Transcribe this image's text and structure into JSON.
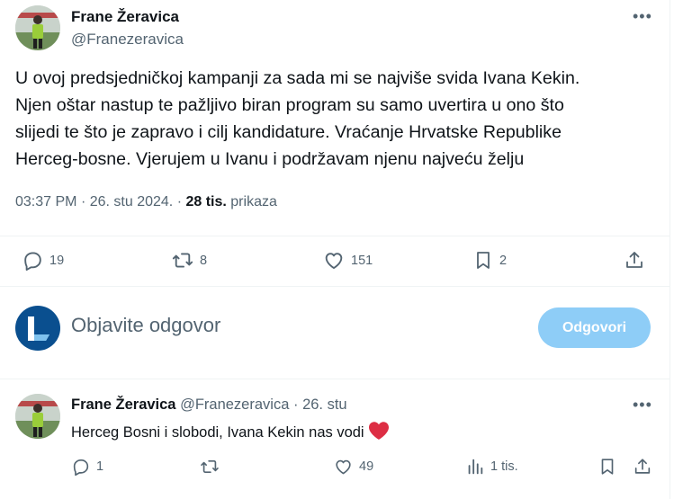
{
  "tweet": {
    "author_name": "Frane Žeravica",
    "author_handle": "@Franezeravica",
    "text": "U ovoj predsjedničkoj kampanji za sada mi se najviše svida Ivana Kekin.\nNjen oštar nastup te pažljivo biran program su samo uvertira u ono što\nslijedi te što je zapravo i cilj  kandidature. Vraćanje Hrvatske Republike\nHerceg-bosne. Vjerujem u Ivanu i podržavam njenu najveću želju",
    "time": "03:37 PM",
    "date": "26. stu 2024.",
    "views_count": "28 tis.",
    "views_label": "prikaza",
    "replies": "19",
    "reposts": "8",
    "likes": "151",
    "bookmarks": "2"
  },
  "composer": {
    "placeholder": "Objavite odgovor",
    "button_label": "Odgovori"
  },
  "reply": {
    "author_name": "Frane Žeravica",
    "author_handle": "@Franezeravica",
    "date": "26. stu",
    "text": "Herceg Bosni i slobodi, Ivana Kekin nas vodi",
    "replies": "1",
    "likes": "49",
    "views": "1 tis."
  },
  "colors": {
    "accent": "#1d9bf0",
    "button_disabled": "#8ecdf7",
    "secondary_text": "#536471",
    "heart": "#f91880"
  },
  "icons": [
    "more-icon",
    "reply-icon",
    "repost-icon",
    "like-icon",
    "bookmark-icon",
    "share-icon",
    "views-icon",
    "heart-emoji-icon"
  ]
}
